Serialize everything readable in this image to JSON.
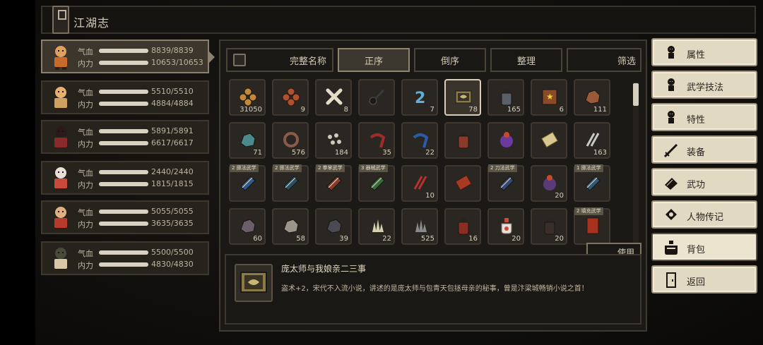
{
  "header": {
    "title": "江湖志",
    "icon": "book-icon"
  },
  "characters": [
    {
      "name": "char-1",
      "portrait": "bald-monk",
      "hp_label": "气血",
      "hp": "8839/8839",
      "hp_frac": 1.0,
      "mp_label": "内力",
      "mp": "10653/10653",
      "mp_frac": 1.0,
      "selected": true
    },
    {
      "name": "char-2",
      "portrait": "fox-fighter",
      "hp_label": "气血",
      "hp": "5510/5510",
      "hp_frac": 1.0,
      "mp_label": "内力",
      "mp": "4884/4884",
      "mp_frac": 1.0
    },
    {
      "name": "char-3",
      "portrait": "black-hat-swordsman",
      "hp_label": "气血",
      "hp": "5891/5891",
      "hp_frac": 1.0,
      "mp_label": "内力",
      "mp": "6617/6617",
      "mp_frac": 1.0
    },
    {
      "name": "char-4",
      "portrait": "silver-hair-sage",
      "hp_label": "气血",
      "hp": "2440/2440",
      "hp_frac": 1.0,
      "mp_label": "内力",
      "mp": "1815/1815",
      "mp_frac": 1.0
    },
    {
      "name": "char-5",
      "portrait": "red-robe-lady",
      "hp_label": "气血",
      "hp": "5055/5055",
      "hp_frac": 1.0,
      "mp_label": "内力",
      "mp": "3635/3635",
      "mp_frac": 1.0
    },
    {
      "name": "char-6",
      "portrait": "green-robe-man",
      "hp_label": "气血",
      "hp": "5500/5500",
      "hp_frac": 1.0,
      "mp_label": "内力",
      "mp": "4830/4830",
      "mp_frac": 1.0
    }
  ],
  "toolbar": {
    "fullname": "完整名称",
    "asc": "正序",
    "desc": "倒序",
    "arrange": "整理",
    "filter": "筛选"
  },
  "items": [
    {
      "icon": "coins-gold",
      "qty": "31050",
      "color": "#c08a3a"
    },
    {
      "icon": "coins-copper",
      "qty": "9",
      "color": "#b0502e"
    },
    {
      "icon": "bone",
      "qty": "8",
      "color": "#e4dcc8"
    },
    {
      "icon": "key",
      "qty": "",
      "color": "#1a1a1a"
    },
    {
      "icon": "blue-rune",
      "qty": "7",
      "color": "#5fb0d8"
    },
    {
      "icon": "tome",
      "qty": "78",
      "color": "#8a7a48",
      "selected": true
    },
    {
      "icon": "jar",
      "qty": "165",
      "color": "#5a6068"
    },
    {
      "icon": "star-book",
      "qty": "6",
      "color": "#8a4a28"
    },
    {
      "icon": "ore",
      "qty": "111",
      "color": "#9a5a3a"
    },
    {
      "icon": "teal-stone",
      "qty": "71",
      "color": "#4a8a8a"
    },
    {
      "icon": "rope",
      "qty": "576",
      "color": "#8a5a4a"
    },
    {
      "icon": "pebbles",
      "qty": "184",
      "color": "#d0c8b8"
    },
    {
      "icon": "red-herb",
      "qty": "35",
      "color": "#a02a2a"
    },
    {
      "icon": "blue-herb",
      "qty": "22",
      "color": "#2a5aa8"
    },
    {
      "icon": "wine-jar",
      "qty": "",
      "color": "#8a3a2a"
    },
    {
      "icon": "fire-orb",
      "qty": "",
      "color": "#6a3aa0"
    },
    {
      "icon": "talisman",
      "qty": "",
      "color": "#d8c890"
    },
    {
      "icon": "feathers",
      "qty": "163",
      "color": "#c8c8c8"
    },
    {
      "icon": "manual-book",
      "qty": "",
      "tag": "2 掷法武学",
      "color": "#2e5a8a"
    },
    {
      "icon": "manual-book",
      "qty": "",
      "tag": "2 掷法武学",
      "color": "#2a5060"
    },
    {
      "icon": "manual-book",
      "qty": "",
      "tag": "2 拳掌武学",
      "color": "#8a3a2a"
    },
    {
      "icon": "manual-book",
      "qty": "",
      "tag": "3 器械武学",
      "color": "#3a6a3a"
    },
    {
      "icon": "red-needles",
      "qty": "10",
      "color": "#b83030"
    },
    {
      "icon": "red-scroll",
      "qty": "",
      "color": "#a83a24"
    },
    {
      "icon": "manual-book",
      "qty": "",
      "tag": "2 刀法武学",
      "color": "#2e4a78"
    },
    {
      "icon": "skull-orb",
      "qty": "20",
      "color": "#5a3a7a"
    },
    {
      "icon": "manual-book",
      "qty": "",
      "tag": "1 掷法武学",
      "color": "#2e5a7a"
    },
    {
      "icon": "grey-ore",
      "qty": "60",
      "color": "#6a5e6a"
    },
    {
      "icon": "stone",
      "qty": "58",
      "color": "#9a948a"
    },
    {
      "icon": "dark-stone",
      "qty": "39",
      "color": "#4a4a52"
    },
    {
      "icon": "crystal",
      "qty": "22",
      "color": "#d4d0b0"
    },
    {
      "icon": "grey-crystal",
      "qty": "525",
      "color": "#8a8a8a"
    },
    {
      "icon": "red-jar",
      "qty": "16",
      "color": "#8a2e22"
    },
    {
      "icon": "potion",
      "qty": "20",
      "color": "#e8e0d8"
    },
    {
      "icon": "dark-jar",
      "qty": "20",
      "color": "#3a2e2a"
    },
    {
      "icon": "red-book",
      "qty": "",
      "tag": "2 填充武学",
      "color": "#a8321e"
    }
  ],
  "use_button": "使用",
  "detail": {
    "icon": "tome",
    "name": "庞太师与我娘亲二三事",
    "desc": "盗术+2，宋代不入流小说，讲述的是庞太师与包青天包拯母亲的秘事，曾是汴梁城畅销小说之首！"
  },
  "menu": [
    {
      "name": "menu-attributes",
      "icon": "person-icon",
      "label": "属性"
    },
    {
      "name": "menu-martial-skills",
      "icon": "skill-person-icon",
      "label": "武学技法"
    },
    {
      "name": "menu-traits",
      "icon": "trait-person-icon",
      "label": "特性"
    },
    {
      "name": "menu-equipment",
      "icon": "sword-icon",
      "label": "装备"
    },
    {
      "name": "menu-martial-arts",
      "icon": "book-icon",
      "label": "武功"
    },
    {
      "name": "menu-biography",
      "icon": "biography-icon",
      "label": "人物传记"
    },
    {
      "name": "menu-bag",
      "icon": "bag-icon",
      "label": "背包",
      "active": true
    },
    {
      "name": "menu-back",
      "icon": "door-icon",
      "label": "返回"
    }
  ]
}
